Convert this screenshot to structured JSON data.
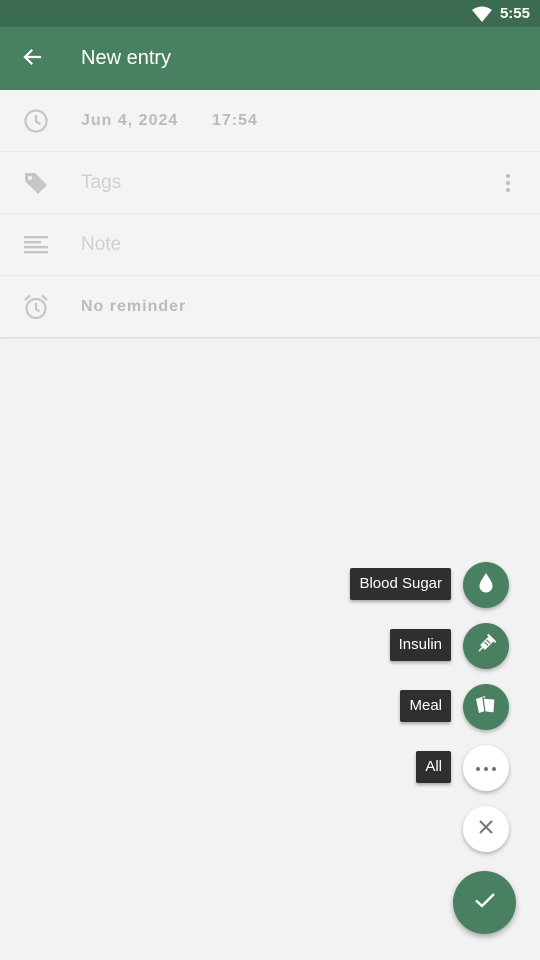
{
  "status_bar": {
    "time": "5:55",
    "wifi_icon": "wifi-icon"
  },
  "app_bar": {
    "back_icon": "arrow-back-icon",
    "title": "New entry"
  },
  "form": {
    "date": {
      "icon": "clock-icon",
      "date_value": "Jun 4, 2024",
      "time_value": "17:54"
    },
    "tags": {
      "icon": "tag-icon",
      "placeholder": "Tags",
      "menu_icon": "more-vert-icon"
    },
    "note": {
      "icon": "notes-icon",
      "placeholder": "Note"
    },
    "reminder": {
      "icon": "alarm-icon",
      "value": "No reminder"
    }
  },
  "fab_menu": {
    "items": [
      {
        "label": "Blood Sugar",
        "icon": "drop-icon"
      },
      {
        "label": "Insulin",
        "icon": "syringe-icon"
      },
      {
        "label": "Meal",
        "icon": "meal-icon"
      },
      {
        "label": "All",
        "icon": "more-horiz-icon"
      }
    ],
    "close_icon": "close-icon",
    "confirm_icon": "check-icon"
  },
  "colors": {
    "status_bar": "#3b6b50",
    "primary": "#4a8062",
    "background": "#f2f2f2",
    "label_bg": "#2f2f2f"
  }
}
